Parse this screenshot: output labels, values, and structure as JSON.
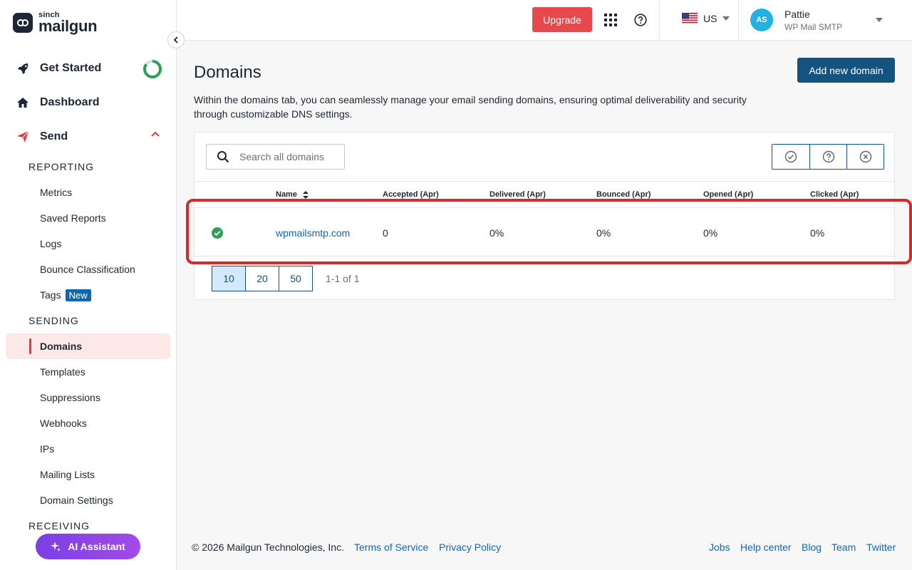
{
  "brand": {
    "small": "sinch",
    "big": "mailgun"
  },
  "sidebar": {
    "get_started": "Get Started",
    "dashboard": "Dashboard",
    "send": "Send",
    "reporting_head": "REPORTING",
    "reporting_items": [
      "Metrics",
      "Saved Reports",
      "Logs",
      "Bounce Classification",
      "Tags"
    ],
    "tags_badge": "New",
    "sending_head": "SENDING",
    "sending_items": [
      "Domains",
      "Templates",
      "Suppressions",
      "Webhooks",
      "IPs",
      "Mailing Lists",
      "Domain Settings"
    ],
    "receiving_head": "RECEIVING",
    "ai_assistant": "AI Assistant",
    "get_started_progress": 0.85
  },
  "topbar": {
    "upgrade": "Upgrade",
    "region": "US",
    "user_initials": "AS",
    "user_name": "Pattie",
    "user_org": "WP Mail SMTP"
  },
  "main": {
    "title": "Domains",
    "add_button": "Add new domain",
    "description": "Within the domains tab, you can seamlessly manage your email sending domains, ensuring optimal deliverability and security through customizable DNS settings.",
    "search_placeholder": "Search all domains",
    "columns": [
      "Name",
      "Accepted (Apr)",
      "Delivered (Apr)",
      "Bounced (Apr)",
      "Opened (Apr)",
      "Clicked (Apr)"
    ],
    "rows": [
      {
        "name": "wpmailsmtp.com",
        "accepted": "0",
        "delivered": "0%",
        "bounced": "0%",
        "opened": "0%",
        "clicked": "0%"
      }
    ],
    "page_sizes": [
      "10",
      "20",
      "50"
    ],
    "page_info": "1-1 of 1"
  },
  "footer": {
    "copyright": "© 2026 Mailgun Technologies, Inc.",
    "terms": "Terms of Service",
    "privacy": "Privacy Policy",
    "jobs": "Jobs",
    "help": "Help center",
    "blog": "Blog",
    "team": "Team",
    "twitter": "Twitter"
  },
  "colors": {
    "accent_red": "#e5484d",
    "primary_blue": "#14527f",
    "link_blue": "#1067b0",
    "success_green": "#2e9e5b"
  }
}
